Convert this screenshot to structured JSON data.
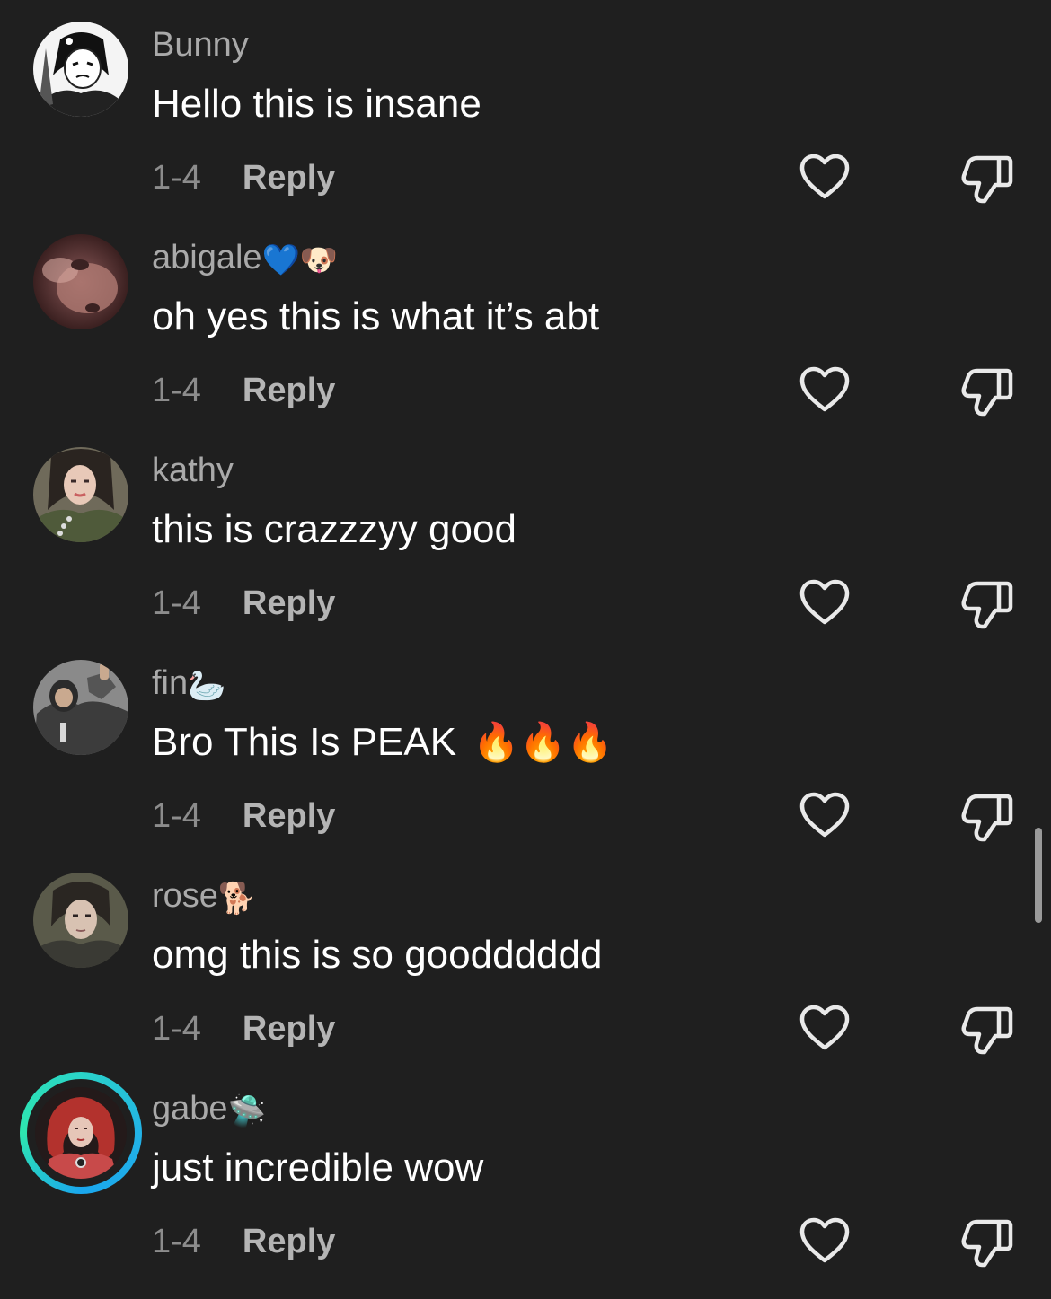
{
  "comments": [
    {
      "username": "Bunny",
      "username_emojis": "",
      "text": "Hello this is insane",
      "text_emojis": "",
      "date": "1-4",
      "reply_label": "Reply",
      "avatar_icon": "anime-avatar",
      "has_story_ring": false
    },
    {
      "username": "abigale",
      "username_emojis": "💙🐶",
      "text": "oh yes this is what it’s abt",
      "text_emojis": "",
      "date": "1-4",
      "reply_label": "Reply",
      "avatar_icon": "photo-avatar",
      "has_story_ring": false
    },
    {
      "username": "kathy",
      "username_emojis": "",
      "text": "this is crazzzyy good",
      "text_emojis": "",
      "date": "1-4",
      "reply_label": "Reply",
      "avatar_icon": "photo-avatar",
      "has_story_ring": false
    },
    {
      "username": "fin",
      "username_emojis": "🦢",
      "text": "Bro This Is PEAK",
      "text_emojis": "🔥🔥🔥",
      "date": "1-4",
      "reply_label": "Reply",
      "avatar_icon": "photo-avatar",
      "has_story_ring": false
    },
    {
      "username": "rose",
      "username_emojis": "🐕",
      "text": "omg this is so goodddddd",
      "text_emojis": "",
      "date": "1-4",
      "reply_label": "Reply",
      "avatar_icon": "photo-avatar",
      "has_story_ring": false
    },
    {
      "username": "gabe",
      "username_emojis": "🛸",
      "text": "just incredible wow",
      "text_emojis": "",
      "date": "1-4",
      "reply_label": "Reply",
      "avatar_icon": "photo-avatar",
      "has_story_ring": true
    }
  ],
  "icons": {
    "like": "heart-outline-icon",
    "dislike": "thumbs-down-outline-icon"
  },
  "colors": {
    "background": "#1f1f1f",
    "username": "#a9a9a9",
    "text": "#ffffff",
    "date": "#8c8c8c",
    "reply": "#b4b4b4",
    "story_ring": "#22b2e6"
  }
}
